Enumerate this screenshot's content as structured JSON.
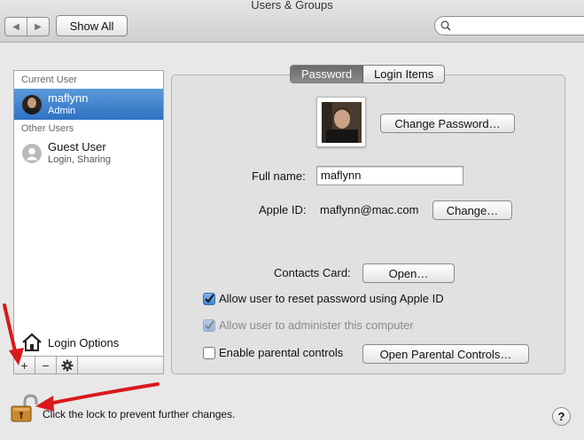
{
  "window": {
    "title": "Users & Groups"
  },
  "toolbar": {
    "show_all_label": "Show All",
    "search_placeholder": ""
  },
  "sidebar": {
    "current_user_header": "Current User",
    "current_user": {
      "name": "maflynn",
      "role": "Admin"
    },
    "other_users_header": "Other Users",
    "guest_user": {
      "name": "Guest User",
      "detail": "Login, Sharing"
    },
    "login_options_label": "Login Options",
    "add_label": "+",
    "remove_label": "−"
  },
  "tabs": [
    {
      "label": "Password",
      "active": true
    },
    {
      "label": "Login Items",
      "active": false
    }
  ],
  "password_pane": {
    "change_password_label": "Change Password…",
    "full_name_label": "Full name:",
    "full_name_value": "maflynn",
    "apple_id_label": "Apple ID:",
    "apple_id_value": "maflynn@mac.com",
    "change_label": "Change…",
    "contacts_card_label": "Contacts Card:",
    "open_label": "Open…",
    "allow_reset_label": "Allow user to reset password using Apple ID",
    "allow_reset_checked": true,
    "allow_admin_label": "Allow user to administer this computer",
    "allow_admin_checked": true,
    "allow_admin_enabled": false,
    "parental_label": "Enable parental controls",
    "parental_checked": false,
    "open_parental_label": "Open Parental Controls…"
  },
  "footer": {
    "lock_text": "Click the lock to prevent further changes.",
    "help_label": "?"
  },
  "colors": {
    "selection": "#2f71c4",
    "annotation_arrow": "#d9191c"
  }
}
